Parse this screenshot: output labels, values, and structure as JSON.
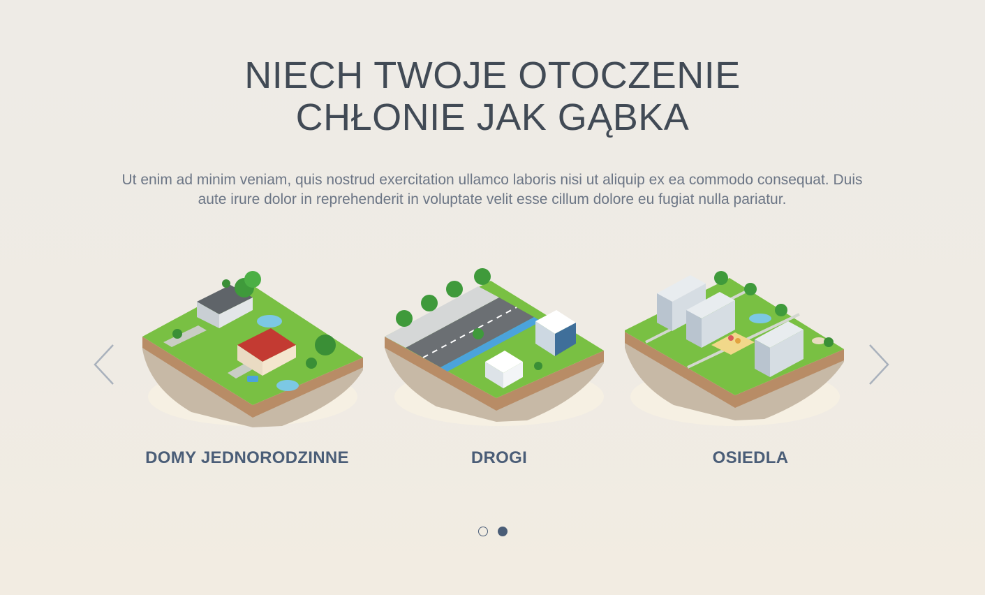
{
  "header": {
    "title_line1": "NIECH TWOJE OTOCZENIE",
    "title_line2": "CHŁONIE JAK GĄBKA",
    "intro": "Ut enim ad minim veniam, quis nostrud exercitation ullamco laboris nisi ut aliquip ex ea commodo consequat. Duis aute irure dolor in reprehenderit in voluptate velit esse cillum dolore eu fugiat nulla pariatur."
  },
  "carousel": {
    "prev_icon": "chevron-left-icon",
    "next_icon": "chevron-right-icon",
    "slides": [
      {
        "label": "DOMY JEDNORODZINNE",
        "image": "single-family-houses-illustration"
      },
      {
        "label": "DROGI",
        "image": "roads-illustration"
      },
      {
        "label": "OSIEDLA",
        "image": "housing-estates-illustration"
      }
    ],
    "pagination": {
      "total": 2,
      "active": 2
    }
  },
  "colors": {
    "background": "#efebe4",
    "title": "#414a55",
    "body_text": "#6b7585",
    "label": "#4a5d77",
    "grass": "#79c043",
    "soil": "#b88c66"
  }
}
